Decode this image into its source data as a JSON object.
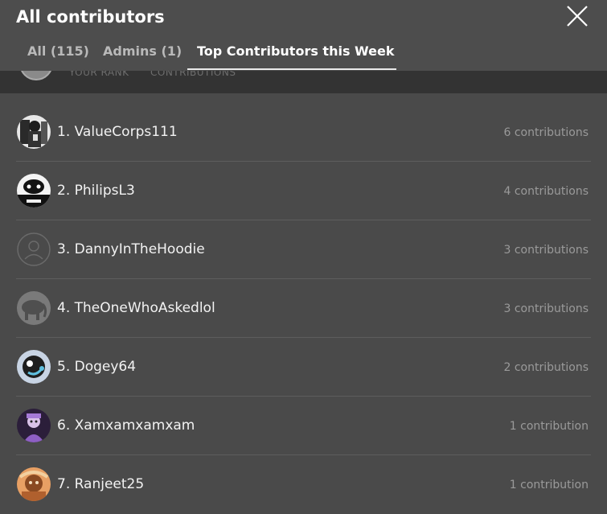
{
  "modal": {
    "title": "All contributors",
    "close_icon": "close-icon"
  },
  "tabs": [
    {
      "label": "All (115)"
    },
    {
      "label": "Admins (1)"
    },
    {
      "label": "Top Contributors this Week",
      "active": true
    }
  ],
  "your_rank": {
    "rank_label": "YOUR RANK",
    "contributions_label": "CONTRIBUTIONS"
  },
  "contributors": [
    {
      "rank_name": "1. ValueCorps111",
      "contributions": "6 contributions",
      "avatar": "bw-photo-avatar"
    },
    {
      "rank_name": "2. PhilipsL3",
      "contributions": "4 contributions",
      "avatar": "bw-photo-avatar"
    },
    {
      "rank_name": "3. DannyInTheHoodie",
      "contributions": "3 contributions",
      "avatar": "default-user-icon"
    },
    {
      "rank_name": "4. TheOneWhoAskedlol",
      "contributions": "3 contributions",
      "avatar": "animal-photo-avatar"
    },
    {
      "rank_name": "5. Dogey64",
      "contributions": "2 contributions",
      "avatar": "cartoon-avatar"
    },
    {
      "rank_name": "6. Xamxamxamxam",
      "contributions": "1 contribution",
      "avatar": "purple-character-avatar"
    },
    {
      "rank_name": "7. Ranjeet25",
      "contributions": "1 contribution",
      "avatar": "orange-photo-avatar"
    }
  ],
  "colors": {
    "background": "#4a4a4a",
    "rank_strip": "#333333",
    "active_tab": "#ffffff",
    "inactive_tab": "#b9b9b9",
    "count_text": "#9a9a9a"
  }
}
